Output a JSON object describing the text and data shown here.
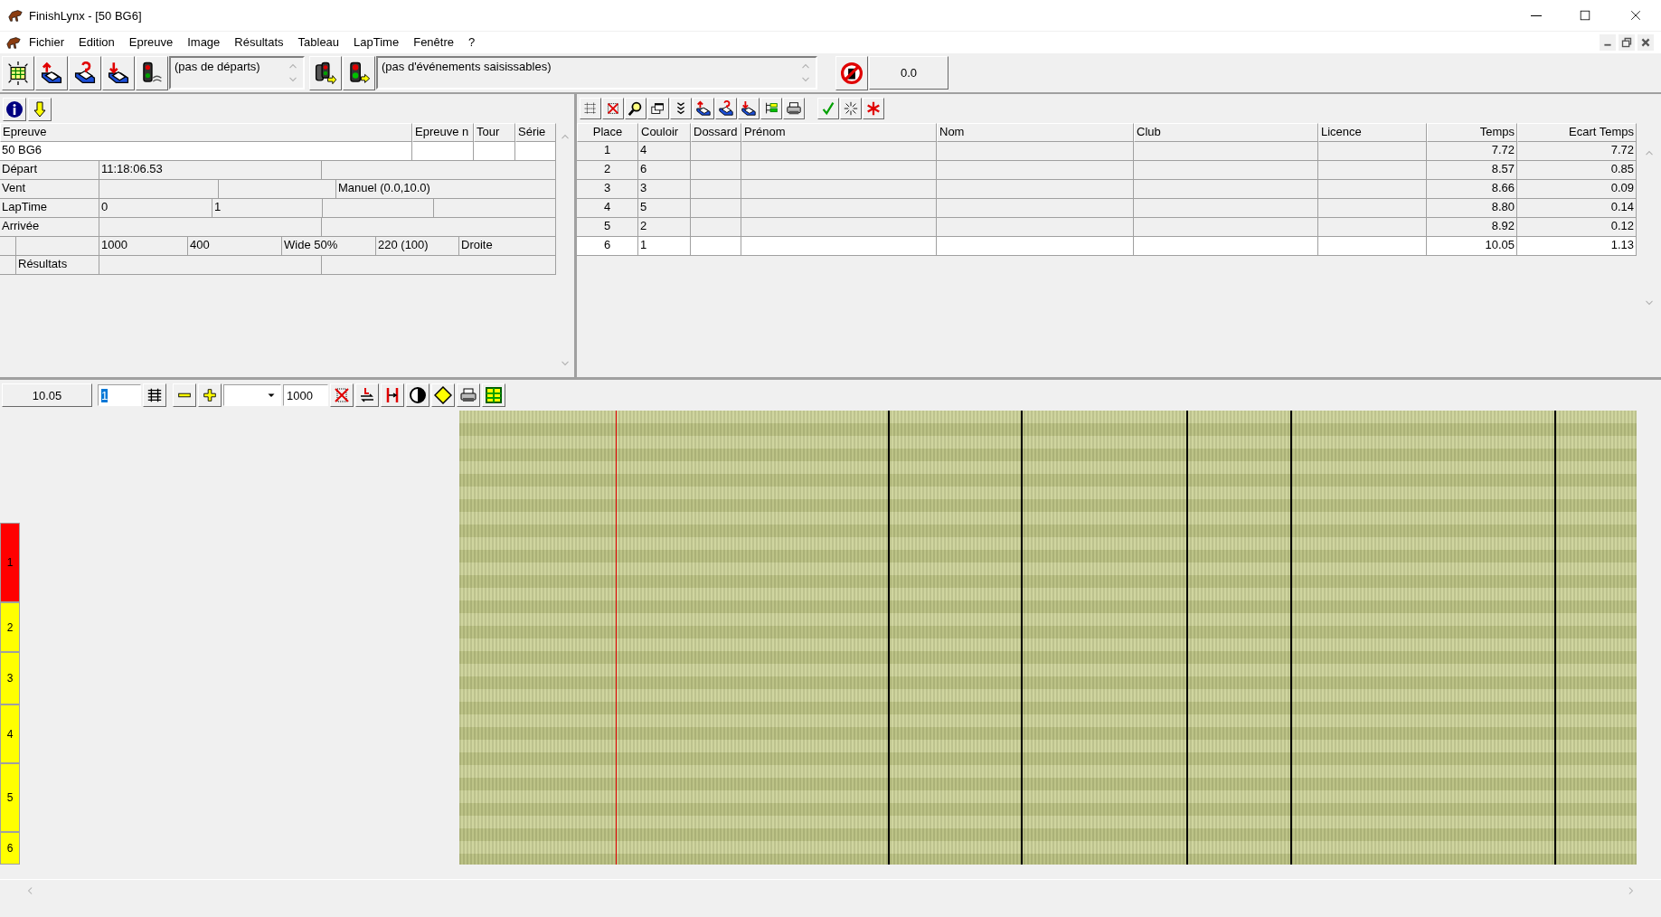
{
  "window": {
    "title": "FinishLynx - [50 BG6]"
  },
  "menu": [
    "Fichier",
    "Edition",
    "Epreuve",
    "Image",
    "Résultats",
    "Tableau",
    "LapTime",
    "Fenêtre",
    "?"
  ],
  "toolbar": {
    "start_list": "(pas de départs)",
    "events_list": "(pas d'événements saisissables)",
    "time_display": "0.0"
  },
  "event_panel": {
    "columns": [
      "Epreuve",
      "Epreuve n",
      "Tour",
      "Série"
    ],
    "event_name": "50 BG6",
    "rows": [
      {
        "kind": "start",
        "label": "Départ",
        "value": "11:18:06.53"
      },
      {
        "kind": "wind",
        "label": "Vent",
        "value": "Manuel (0.0,10.0)"
      },
      {
        "kind": "laps",
        "label": "LapTime",
        "values": [
          "0",
          "1"
        ]
      },
      {
        "kind": "finish",
        "label": "Arrivée"
      },
      {
        "kind": "camera",
        "values": [
          "1000",
          "400",
          "Wide 50%",
          "220  (100)",
          "Droite"
        ]
      },
      {
        "kind": "results",
        "label": "Résultats"
      }
    ]
  },
  "results": {
    "columns": [
      "Place",
      "Couloir",
      "Dossard",
      "Prénom",
      "Nom",
      "Club",
      "Licence",
      "Temps",
      "Ecart Temps"
    ],
    "rows": [
      {
        "place": "1",
        "lane": "4",
        "time": "7.72",
        "gap": "7.72",
        "selected": false
      },
      {
        "place": "2",
        "lane": "6",
        "time": "8.57",
        "gap": "0.85",
        "selected": false
      },
      {
        "place": "3",
        "lane": "3",
        "time": "8.66",
        "gap": "0.09",
        "selected": false
      },
      {
        "place": "4",
        "lane": "5",
        "time": "8.80",
        "gap": "0.14",
        "selected": false
      },
      {
        "place": "5",
        "lane": "2",
        "time": "8.92",
        "gap": "0.12",
        "selected": false
      },
      {
        "place": "6",
        "lane": "1",
        "time": "10.05",
        "gap": "1.13",
        "selected": true
      }
    ]
  },
  "image_toolbar": {
    "time": "10.05",
    "frame": "1",
    "frame_selected": true,
    "zoom": "1000"
  },
  "lanes": [
    {
      "label": "1",
      "color": "#ff0000"
    },
    {
      "label": "2",
      "color": "#ffff00"
    },
    {
      "label": "3",
      "color": "#ffff00"
    },
    {
      "label": "4",
      "color": "#ffff00"
    },
    {
      "label": "5",
      "color": "#ffff00"
    },
    {
      "label": "6",
      "color": "#ffff00"
    }
  ]
}
